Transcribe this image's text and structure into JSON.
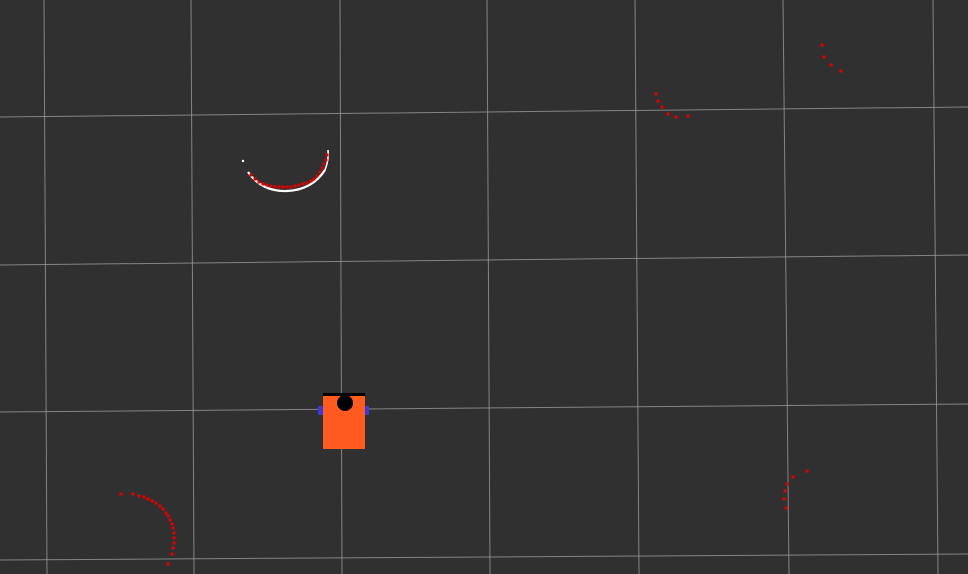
{
  "view": {
    "background_color": "#303030",
    "grid_color": "#a0a0a0",
    "grid_visible": true
  },
  "robot": {
    "body_color": "#ff5a1f",
    "lidar_color": "#000000",
    "wheel_color": "#3a3ad8"
  },
  "laser_scan": {
    "point_color": "#e00000"
  },
  "detected_object": {
    "outline_color": "#ffffff"
  }
}
